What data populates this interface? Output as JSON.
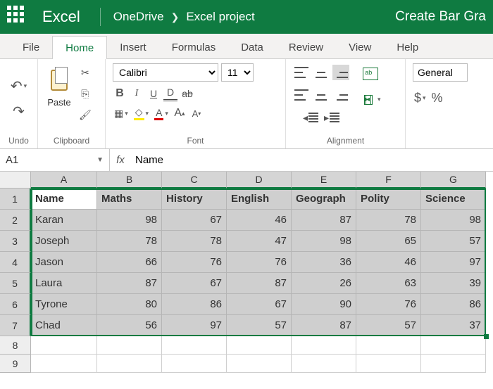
{
  "titlebar": {
    "app": "Excel",
    "location": "OneDrive",
    "project": "Excel project",
    "document": "Create Bar Gra"
  },
  "tabs": [
    "File",
    "Home",
    "Insert",
    "Formulas",
    "Data",
    "Review",
    "View",
    "Help"
  ],
  "active_tab": 1,
  "ribbon": {
    "undo_label": "Undo",
    "clipboard_label": "Clipboard",
    "paste_label": "Paste",
    "font_label": "Font",
    "font_name": "Calibri",
    "font_size": "11",
    "alignment_label": "Alignment",
    "number_format": "General",
    "currency": "$"
  },
  "formula_bar": {
    "cell_ref": "A1",
    "fx": "fx",
    "value": "Name"
  },
  "grid": {
    "columns": [
      "A",
      "B",
      "C",
      "D",
      "E",
      "F",
      "G"
    ],
    "headers": [
      "Name",
      "Maths",
      "History",
      "English",
      "Geograph",
      "Polity",
      "Science"
    ],
    "rows": [
      {
        "name": "Karan",
        "v": [
          98,
          67,
          46,
          87,
          78,
          98
        ]
      },
      {
        "name": "Joseph",
        "v": [
          78,
          78,
          47,
          98,
          65,
          57
        ]
      },
      {
        "name": "Jason",
        "v": [
          66,
          76,
          76,
          36,
          46,
          97
        ]
      },
      {
        "name": "Laura",
        "v": [
          87,
          67,
          87,
          26,
          63,
          39
        ]
      },
      {
        "name": "Tyrone",
        "v": [
          80,
          86,
          67,
          90,
          76,
          86
        ]
      },
      {
        "name": "Chad",
        "v": [
          56,
          97,
          57,
          87,
          57,
          37
        ]
      }
    ],
    "visible_rows": 9,
    "selected_rows": 7,
    "selected_cols": 7,
    "active_cell": "A1"
  }
}
